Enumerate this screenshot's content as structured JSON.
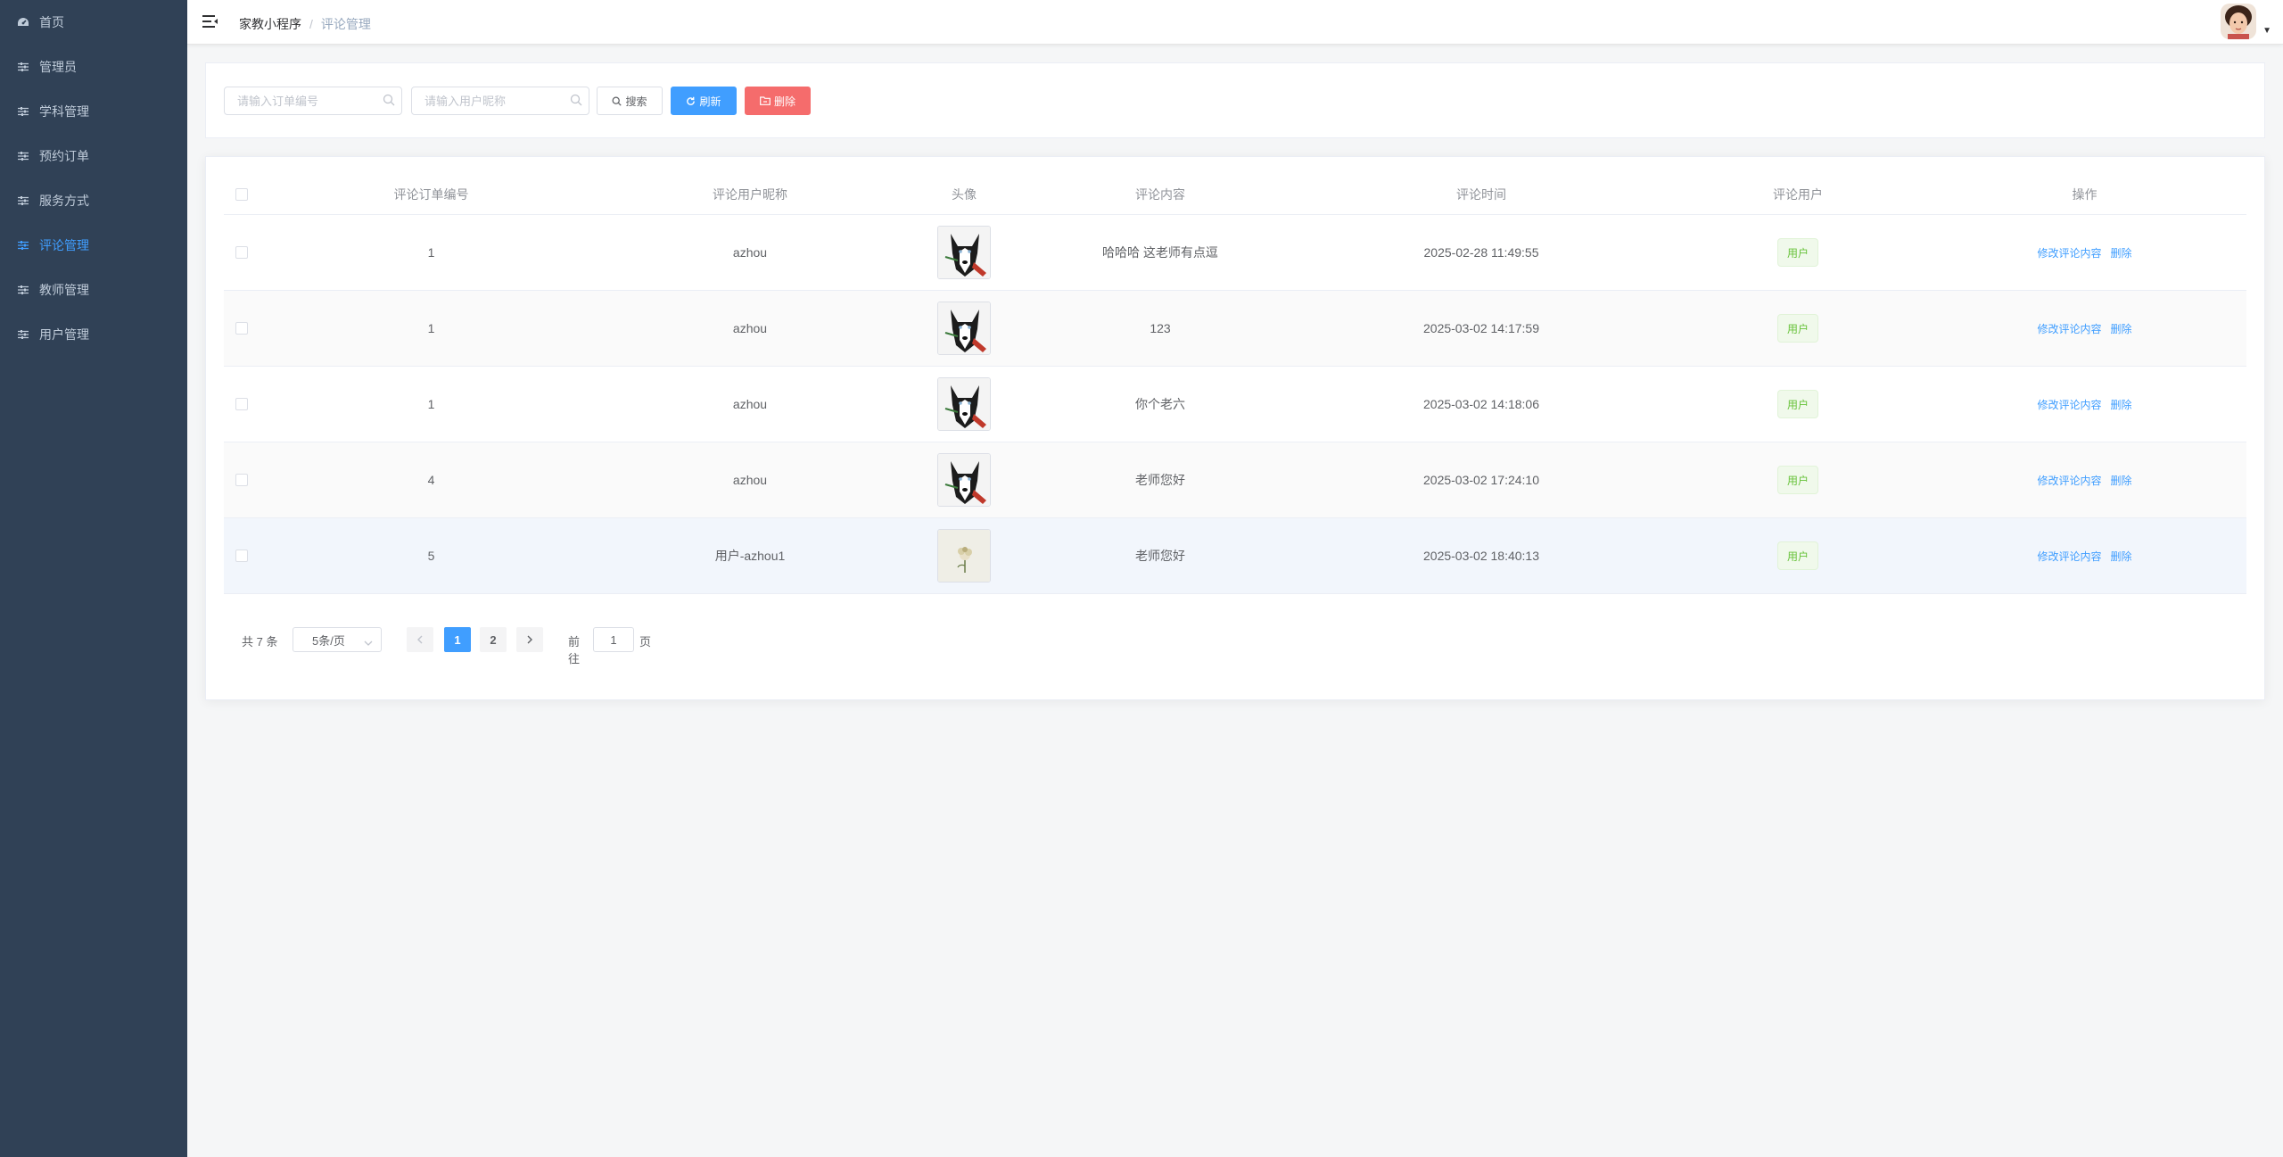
{
  "sidebar": {
    "items": [
      {
        "label": "首页",
        "icon": "dashboard-icon",
        "active": false
      },
      {
        "label": "管理员",
        "icon": "sliders-icon",
        "active": false
      },
      {
        "label": "学科管理",
        "icon": "sliders-icon",
        "active": false
      },
      {
        "label": "预约订单",
        "icon": "sliders-icon",
        "active": false
      },
      {
        "label": "服务方式",
        "icon": "sliders-icon",
        "active": false
      },
      {
        "label": "评论管理",
        "icon": "sliders-icon",
        "active": true
      },
      {
        "label": "教师管理",
        "icon": "sliders-icon",
        "active": false
      },
      {
        "label": "用户管理",
        "icon": "sliders-icon",
        "active": false
      }
    ]
  },
  "header": {
    "breadcrumb_root": "家教小程序",
    "breadcrumb_sep": "/",
    "breadcrumb_current": "评论管理"
  },
  "search": {
    "order_placeholder": "请输入订单编号",
    "nickname_placeholder": "请输入用户昵称",
    "search_label": "搜索",
    "refresh_label": "刷新",
    "delete_label": "删除"
  },
  "table": {
    "columns": {
      "order_no": "评论订单编号",
      "nickname": "评论用户昵称",
      "avatar": "头像",
      "content": "评论内容",
      "time": "评论时间",
      "user": "评论用户",
      "ops": "操作"
    },
    "rows": [
      {
        "order_no": "1",
        "nickname": "azhou",
        "avatar": "husky",
        "content": "哈哈哈 这老师有点逗",
        "time": "2025-02-28 11:49:55",
        "user_tag": "用户"
      },
      {
        "order_no": "1",
        "nickname": "azhou",
        "avatar": "husky",
        "content": "123",
        "time": "2025-03-02 14:17:59",
        "user_tag": "用户"
      },
      {
        "order_no": "1",
        "nickname": "azhou",
        "avatar": "husky",
        "content": "你个老六",
        "time": "2025-03-02 14:18:06",
        "user_tag": "用户"
      },
      {
        "order_no": "4",
        "nickname": "azhou",
        "avatar": "husky",
        "content": "老师您好",
        "time": "2025-03-02 17:24:10",
        "user_tag": "用户"
      },
      {
        "order_no": "5",
        "nickname": "用户-azhou1",
        "avatar": "flower",
        "content": "老师您好",
        "time": "2025-03-02 18:40:13",
        "user_tag": "用户"
      }
    ],
    "edit_label": "修改评论内容",
    "delete_label": "删除"
  },
  "pagination": {
    "total_text": "共 7 条",
    "page_size": "5条/页",
    "pages": [
      "1",
      "2"
    ],
    "current_page": 1,
    "goto_label": "前往",
    "goto_value": "1",
    "page_unit": "页"
  },
  "colors": {
    "sidebar_bg": "#304156",
    "accent": "#409eff",
    "danger": "#f56c6c",
    "success": "#67c23a"
  }
}
